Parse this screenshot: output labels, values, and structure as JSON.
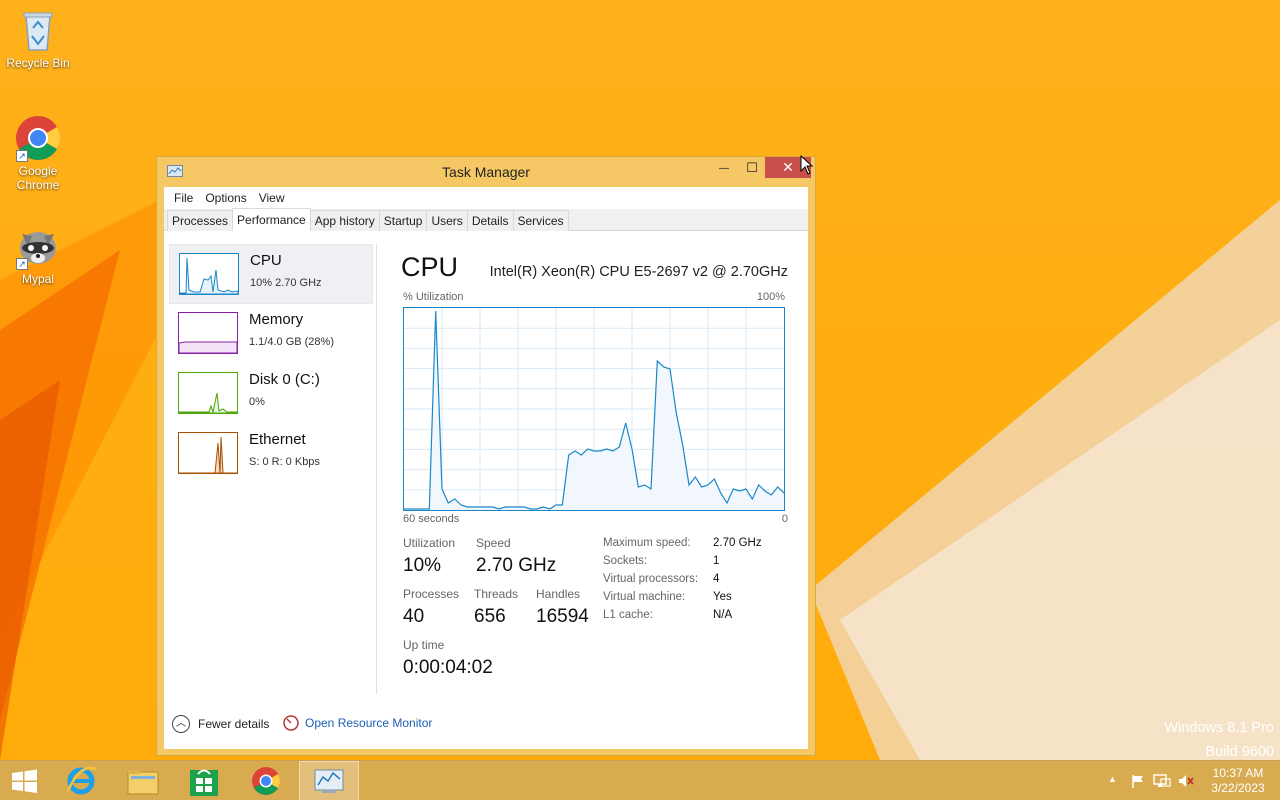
{
  "desktop": {
    "icons": [
      {
        "label": "Recycle Bin"
      },
      {
        "label": "Google\nChrome"
      },
      {
        "label": "Mypal"
      }
    ],
    "watermark": {
      "line1": "Windows 8.1 Pro",
      "line2": "Build 9600"
    }
  },
  "window": {
    "title": "Task Manager",
    "close_glyph": "✕",
    "min_glyph": "—",
    "max_glyph": "☐",
    "menu": [
      "File",
      "Options",
      "View"
    ],
    "tabs": [
      "Processes",
      "Performance",
      "App history",
      "Startup",
      "Users",
      "Details",
      "Services"
    ],
    "active_tab": "Performance"
  },
  "sidebar": {
    "items": [
      {
        "title": "CPU",
        "sub": "10% 2.70 GHz",
        "color": "#1b87c8"
      },
      {
        "title": "Memory",
        "sub": "1.1/4.0 GB (28%)",
        "color": "#8b1fa8"
      },
      {
        "title": "Disk 0 (C:)",
        "sub": "0%",
        "color": "#4da60c"
      },
      {
        "title": "Ethernet",
        "sub": "S: 0 R: 0 Kbps",
        "color": "#a74f01"
      }
    ]
  },
  "main": {
    "title": "CPU",
    "cpu_name": "Intel(R) Xeon(R) CPU E5-2697 v2 @ 2.70GHz",
    "y_label": "% Utilization",
    "y_max": "100%",
    "x_left": "60 seconds",
    "x_right": "0",
    "stats": {
      "utilization_label": "Utilization",
      "utilization": "10%",
      "speed_label": "Speed",
      "speed": "2.70 GHz",
      "processes_label": "Processes",
      "processes": "40",
      "threads_label": "Threads",
      "threads": "656",
      "handles_label": "Handles",
      "handles": "16594",
      "uptime_label": "Up time",
      "uptime": "0:00:04:02"
    },
    "details": [
      {
        "label": "Maximum speed:",
        "value": "2.70 GHz"
      },
      {
        "label": "Sockets:",
        "value": "1"
      },
      {
        "label": "Virtual processors:",
        "value": "4"
      },
      {
        "label": "Virtual machine:",
        "value": "Yes"
      },
      {
        "label": "L1 cache:",
        "value": "N/A"
      }
    ]
  },
  "footer": {
    "fewer_details": "Fewer details",
    "resource_monitor": "Open Resource Monitor"
  },
  "taskbar": {
    "clock_time": "10:37 AM",
    "clock_date": "3/22/2023",
    "tray_overflow_glyph": "▲"
  },
  "chart_data": {
    "type": "area",
    "x": [
      60,
      59,
      58,
      57,
      56,
      55,
      54,
      53,
      52,
      51,
      50,
      49,
      48,
      47,
      46,
      45,
      44,
      43,
      42,
      41,
      40,
      39,
      38,
      37,
      36,
      35,
      34,
      33,
      32,
      31,
      30,
      29,
      28,
      27,
      26,
      25,
      24,
      23,
      22,
      21,
      20,
      19,
      18,
      17,
      16,
      15,
      14,
      13,
      12,
      11,
      10,
      9,
      8,
      7,
      6,
      5,
      4,
      3,
      2,
      1,
      0
    ],
    "values": [
      0,
      0,
      0,
      0,
      0,
      99,
      10,
      3,
      5,
      2,
      1,
      1,
      1,
      1,
      1,
      0,
      1,
      1,
      1,
      1,
      0,
      0,
      1,
      0,
      2,
      2,
      27,
      29,
      27,
      30,
      29,
      29,
      30,
      29,
      31,
      43,
      30,
      11,
      12,
      10,
      74,
      71,
      70,
      48,
      32,
      12,
      16,
      11,
      12,
      15,
      8,
      3,
      10,
      9,
      10,
      5,
      12,
      9,
      7,
      11,
      8
    ],
    "ylim": [
      0,
      100
    ],
    "xlabel": "60 seconds",
    "ylabel": "% Utilization"
  }
}
